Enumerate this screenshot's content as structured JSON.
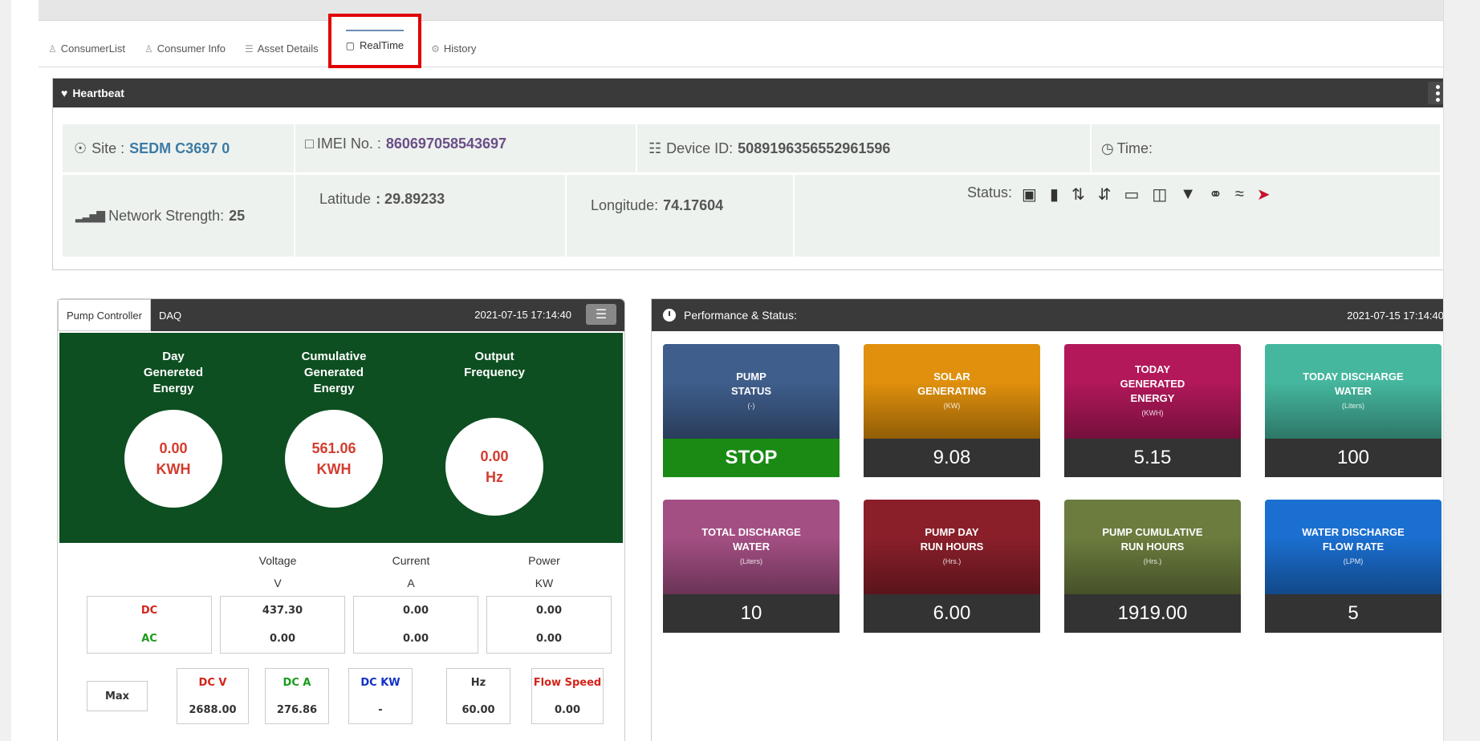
{
  "tabs": [
    {
      "label": "ConsumerList",
      "icon": "user-icon"
    },
    {
      "label": "Consumer Info",
      "icon": "user-icon"
    },
    {
      "label": "Asset Details",
      "icon": "list-icon"
    },
    {
      "label": "RealTime",
      "icon": "monitor-icon"
    },
    {
      "label": "History",
      "icon": "gear-icon"
    }
  ],
  "heartbeat": {
    "title": "Heartbeat",
    "site_label": "Site :",
    "site_value": "SEDM C3697 0",
    "imei_label": "IMEI No. :",
    "imei_value": "860697058543697",
    "device_label": "Device ID:",
    "device_value": "5089196356552961596",
    "time_label": "Time:",
    "network_label": "Network Strength:",
    "network_value": "25",
    "lat_label": "Latitude",
    "lat_value": ": 29.89233",
    "lon_label": "Longitude:",
    "lon_value": "74.17604",
    "status_label": "Status:"
  },
  "pump_controller": {
    "tab1": "Pump Controller",
    "tab2": "DAQ",
    "timestamp": "2021-07-15 17:14:40",
    "meters": [
      {
        "l1": "Day",
        "l2": "Genereted",
        "l3": "Energy",
        "value": "0.00",
        "unit": "KWH"
      },
      {
        "l1": "Cumulative",
        "l2": "Generated",
        "l3": "Energy",
        "value": "561.06",
        "unit": "KWH"
      },
      {
        "l1": "Output",
        "l2": "Frequency",
        "l3": "",
        "value": "0.00",
        "unit": "Hz"
      }
    ],
    "headers": {
      "voltage": "Voltage",
      "current": "Current",
      "power": "Power",
      "v": "V",
      "a": "A",
      "kw": "KW"
    },
    "dc_label": "DC",
    "ac_label": "AC",
    "dc_voltage": "437.30",
    "ac_voltage": "0.00",
    "dc_current": "0.00",
    "ac_current": "0.00",
    "dc_power": "0.00",
    "ac_power": "0.00",
    "max_label": "Max",
    "max": [
      {
        "label": "DC V",
        "value": "2688.00"
      },
      {
        "label": "DC A",
        "value": "276.86"
      },
      {
        "label": "DC KW",
        "value": "-"
      },
      {
        "label": "Hz",
        "value": "60.00"
      },
      {
        "label": "Flow Speed",
        "value": "0.00"
      }
    ]
  },
  "performance": {
    "title": "Performance & Status:",
    "timestamp": "2021-07-15 17:14:40",
    "cards": [
      {
        "l1": "PUMP",
        "l2": "STATUS",
        "l3": "",
        "unit": "(-)",
        "value": "STOP",
        "color": "#3f5e8c"
      },
      {
        "l1": "SOLAR",
        "l2": "GENERATING",
        "l3": "",
        "unit": "(KW)",
        "value": "9.08",
        "color": "#e0900c"
      },
      {
        "l1": "TODAY",
        "l2": "GENERATED",
        "l3": "ENERGY",
        "unit": "(KWH)",
        "value": "5.15",
        "color": "#b2185a"
      },
      {
        "l1": "TODAY DISCHARGE",
        "l2": "WATER",
        "l3": "",
        "unit": "(Liters)",
        "value": "100",
        "color": "#45b79e"
      },
      {
        "l1": "TOTAL DISCHARGE",
        "l2": "WATER",
        "l3": "",
        "unit": "(Liters)",
        "value": "10",
        "color": "#a44f84"
      },
      {
        "l1": "PUMP DAY",
        "l2": "RUN HOURS",
        "l3": "",
        "unit": "(Hrs.)",
        "value": "6.00",
        "color": "#8a1f2a"
      },
      {
        "l1": "PUMP CUMULATIVE",
        "l2": "RUN HOURS",
        "l3": "",
        "unit": "(Hrs.)",
        "value": "1919.00",
        "color": "#6b7c3e"
      },
      {
        "l1": "WATER DISCHARGE",
        "l2": "FLOW RATE",
        "l3": "",
        "unit": "(LPM)",
        "value": "5",
        "color": "#1b6fd1"
      }
    ]
  }
}
